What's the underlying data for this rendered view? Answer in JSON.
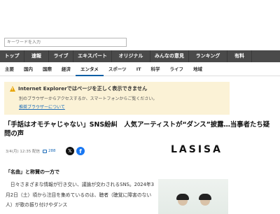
{
  "search": {
    "placeholder": "キーワードを入力"
  },
  "nav_primary": [
    {
      "label": "トップ",
      "active": false
    },
    {
      "label": "速報",
      "active": false
    },
    {
      "label": "ライブ",
      "active": false
    },
    {
      "label": "エキスパート",
      "active": false
    },
    {
      "label": "オリジナル",
      "active": false
    },
    {
      "label": "みんなの意見",
      "active": false
    },
    {
      "label": "ランキング",
      "active": false
    },
    {
      "label": "有料",
      "active": false
    }
  ],
  "nav_secondary": [
    {
      "label": "主要"
    },
    {
      "label": "国内"
    },
    {
      "label": "国際"
    },
    {
      "label": "経済"
    },
    {
      "label": "エンタメ",
      "active": true
    },
    {
      "label": "スポーツ"
    },
    {
      "label": "IT"
    },
    {
      "label": "科学"
    },
    {
      "label": "ライフ"
    },
    {
      "label": "地域"
    }
  ],
  "browser_warning": {
    "title": "Internet Explorerではページを正しく表示できません",
    "body": "別のブラウザーからアクセスするか、スマートフォンからご覧ください。",
    "link": "推奨ブラウザーについて"
  },
  "article": {
    "headline": "「手話はオモチャじゃない」SNS紛糾　人気アーティストが“ダンス”披露…当事者たち疑問の声",
    "date": "3/4(月) 12:35 配信",
    "comment_count": "288",
    "brand": "LASISA",
    "subhead": "「名曲」と称賛の一方で",
    "body": "　日々さまざまな情報が行き交い、議論が交わされるSNS。2024年3月2日（土）頃から注目を集めているのは、聴者（聴覚に障害のない人）が歌の振り付けやダンス"
  },
  "colors": {
    "nav_bg": "#4a4a4a",
    "nav_active": "#2f6ea8",
    "warning_bg": "#fbf2d6",
    "link": "#1a6bb8"
  }
}
